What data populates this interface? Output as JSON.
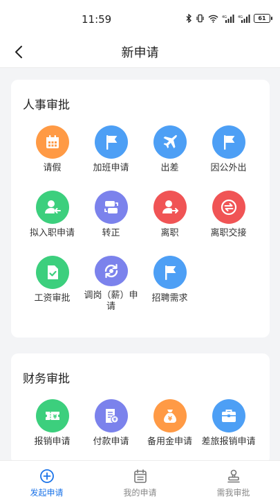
{
  "status": {
    "time": "11:59",
    "battery": "61"
  },
  "nav": {
    "title": "新申请"
  },
  "colors": {
    "orange": "#ff9a45",
    "blue": "#4d9ff5",
    "green": "#3ccf7d",
    "purple": "#7b82ec",
    "red": "#f05455",
    "active": "#1a73e8"
  },
  "hr": {
    "title": "人事审批",
    "items": [
      {
        "label": "请假",
        "icon": "calendar-icon",
        "color": "#ff9a45"
      },
      {
        "label": "加班申请",
        "icon": "flag-icon",
        "color": "#4d9ff5"
      },
      {
        "label": "出差",
        "icon": "airplane-icon",
        "color": "#4d9ff5"
      },
      {
        "label": "因公外出",
        "icon": "flag-icon",
        "color": "#4d9ff5"
      },
      {
        "label": "拟入职申请",
        "icon": "user-add-icon",
        "color": "#3ccf7d"
      },
      {
        "label": "转正",
        "icon": "swap-icon",
        "color": "#7b82ec"
      },
      {
        "label": "离职",
        "icon": "user-leave-icon",
        "color": "#f05455"
      },
      {
        "label": "离职交接",
        "icon": "exchange-icon",
        "color": "#f05455"
      },
      {
        "label": "工资审批",
        "icon": "document-check-icon",
        "color": "#3ccf7d"
      },
      {
        "label": "调岗（薪）申请",
        "icon": "refresh-icon",
        "color": "#7b82ec"
      },
      {
        "label": "招聘需求",
        "icon": "flag-icon",
        "color": "#4d9ff5"
      }
    ]
  },
  "finance": {
    "title": "财务审批",
    "items": [
      {
        "label": "报销申请",
        "icon": "ticket-icon",
        "color": "#3ccf7d"
      },
      {
        "label": "付款申请",
        "icon": "invoice-icon",
        "color": "#7b82ec"
      },
      {
        "label": "备用金申请",
        "icon": "money-bag-icon",
        "color": "#ff9a45"
      },
      {
        "label": "差旅报销申请",
        "icon": "briefcase-icon",
        "color": "#4d9ff5"
      }
    ]
  },
  "tabs": [
    {
      "label": "发起申请",
      "icon": "plus-circle-icon",
      "active": true
    },
    {
      "label": "我的申请",
      "icon": "calendar-list-icon",
      "active": false
    },
    {
      "label": "需我审批",
      "icon": "stamp-icon",
      "active": false
    }
  ]
}
